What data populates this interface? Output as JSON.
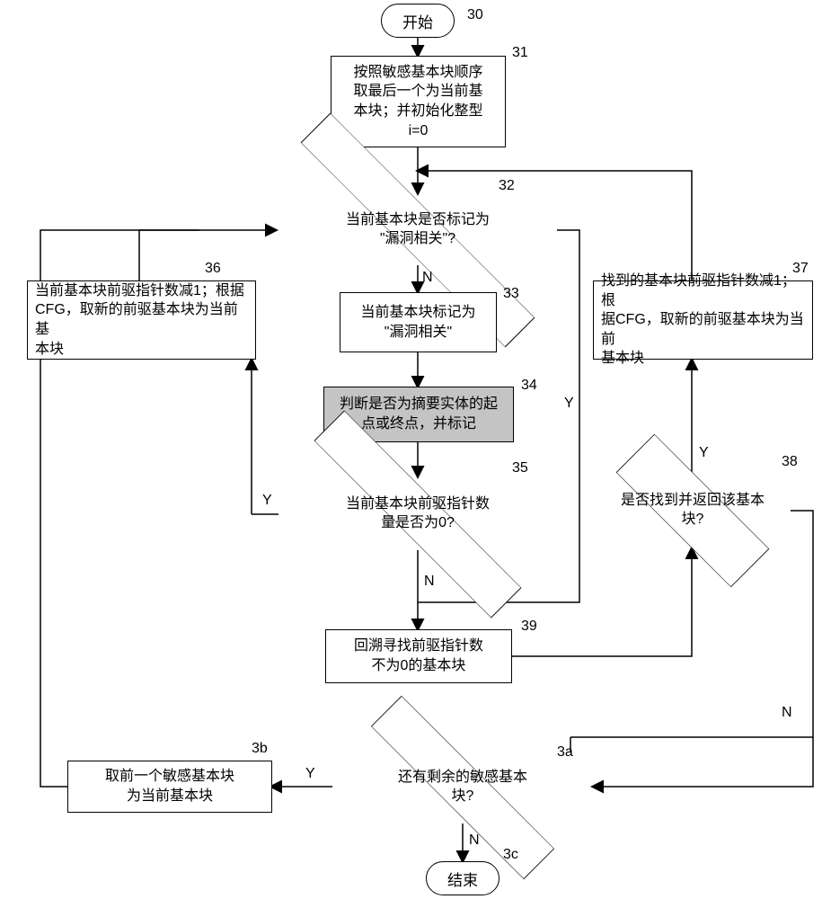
{
  "labels": {
    "n30": "30",
    "n31": "31",
    "n32": "32",
    "n33": "33",
    "n34": "34",
    "n35": "35",
    "n36": "36",
    "n37": "37",
    "n38": "38",
    "n39": "39",
    "n3a": "3a",
    "n3b": "3b",
    "n3c": "3c"
  },
  "nodes": {
    "start": "开始",
    "end": "结束",
    "b31": "按照敏感基本块顺序\n取最后一个为当前基\n本块；并初始化整型\ni=0",
    "d32": "当前基本块是否标记为\n\"漏洞相关\"?",
    "b33": "当前基本块标记为\n\"漏洞相关\"",
    "b34": "判断是否为摘要实体的起\n点或终点，并标记",
    "d35": "当前基本块前驱指针数\n量是否为0?",
    "b36": "当前基本块前驱指针数减1；根据\nCFG，取新的前驱基本块为当前基\n本块",
    "b37": "找到的基本块前驱指针数减1；根\n据CFG，取新的前驱基本块为当前\n基本块",
    "d38": "是否找到并返回该基本\n块?",
    "b39": "回溯寻找前驱指针数\n不为0的基本块",
    "d3a": "还有剩余的敏感基本\n块?",
    "b3b": "取前一个敏感基本块\n为当前基本块"
  },
  "yn": {
    "Y": "Y",
    "N": "N"
  },
  "chart_data": {
    "type": "flowchart",
    "title": "",
    "nodes": [
      {
        "id": "30",
        "type": "terminator",
        "text": "开始"
      },
      {
        "id": "31",
        "type": "process",
        "text": "按照敏感基本块顺序取最后一个为当前基本块；并初始化整型 i=0"
      },
      {
        "id": "32",
        "type": "decision",
        "text": "当前基本块是否标记为\"漏洞相关\"?"
      },
      {
        "id": "33",
        "type": "process",
        "text": "当前基本块标记为\"漏洞相关\""
      },
      {
        "id": "34",
        "type": "process",
        "text": "判断是否为摘要实体的起点或终点，并标记",
        "shaded": true
      },
      {
        "id": "35",
        "type": "decision",
        "text": "当前基本块前驱指针数量是否为0?"
      },
      {
        "id": "36",
        "type": "process",
        "text": "当前基本块前驱指针数减1；根据CFG，取新的前驱基本块为当前基本块"
      },
      {
        "id": "37",
        "type": "process",
        "text": "找到的基本块前驱指针数减1；根据CFG，取新的前驱基本块为当前基本块"
      },
      {
        "id": "38",
        "type": "decision",
        "text": "是否找到并返回该基本块?"
      },
      {
        "id": "39",
        "type": "process",
        "text": "回溯寻找前驱指针数不为0的基本块"
      },
      {
        "id": "3a",
        "type": "decision",
        "text": "还有剩余的敏感基本块?"
      },
      {
        "id": "3b",
        "type": "process",
        "text": "取前一个敏感基本块为当前基本块"
      },
      {
        "id": "3c",
        "type": "terminator",
        "text": "结束"
      }
    ],
    "edges": [
      {
        "from": "30",
        "to": "31"
      },
      {
        "from": "31",
        "to": "32"
      },
      {
        "from": "32",
        "to": "33",
        "label": "N"
      },
      {
        "from": "32",
        "to": "39",
        "label": "Y",
        "note": "bypass to join before 39 via right side"
      },
      {
        "from": "33",
        "to": "34"
      },
      {
        "from": "34",
        "to": "35"
      },
      {
        "from": "35",
        "to": "36",
        "label": "Y"
      },
      {
        "from": "35",
        "to": "39",
        "label": "N"
      },
      {
        "from": "36",
        "to": "32",
        "note": "loop back"
      },
      {
        "from": "39",
        "to": "38"
      },
      {
        "from": "38",
        "to": "37",
        "label": "Y"
      },
      {
        "from": "37",
        "to": "32",
        "note": "loop back"
      },
      {
        "from": "38",
        "to": "3a",
        "label": "N"
      },
      {
        "from": "3a",
        "to": "3b",
        "label": "Y"
      },
      {
        "from": "3b",
        "to": "32",
        "note": "loop back"
      },
      {
        "from": "3a",
        "to": "3c",
        "label": "N"
      }
    ]
  }
}
